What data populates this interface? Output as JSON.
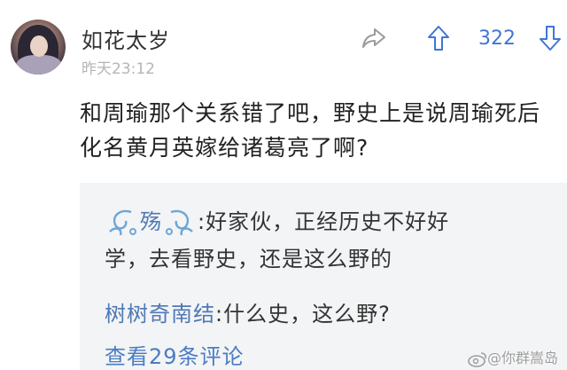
{
  "post": {
    "username": "如花太岁",
    "timestamp": "昨天23:12",
    "vote_count": "322",
    "body": "和周瑜那个关系错了吧，野史上是说周瑜死后化名黄月英嫁给诸葛亮了啊?"
  },
  "comments": [
    {
      "author": "殇",
      "separator": ":",
      "line1": "好家伙，正经历史不好好",
      "line2": "学，去看野史，还是这么野的"
    },
    {
      "author": "树树奇南结",
      "separator": ":",
      "text": "什么史，这么野?"
    }
  ],
  "more_comments_label": "查看29条评论",
  "watermark": "@你群嵩岛",
  "icons": {
    "share": "share-icon",
    "upvote": "upvote-icon",
    "downvote": "downvote-icon",
    "weibo": "weibo-icon"
  },
  "colors": {
    "accent_blue": "#3f76d6",
    "comment_name": "#4f79b5",
    "link": "#4b7cc4",
    "comment_bg": "#f3f4f6",
    "muted": "#b5b5b5"
  }
}
